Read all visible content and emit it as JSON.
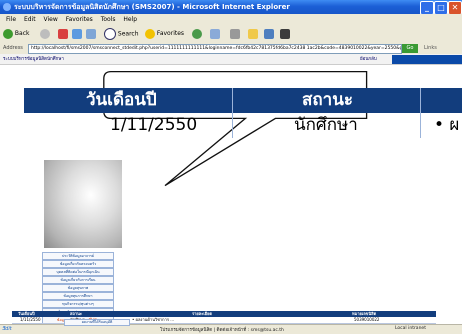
{
  "window": {
    "title": "ระบบบริหารจัดการข้อมูลนิสิตนักศึกษา (SMS2007) - Microsoft Internet Explorer",
    "minimize": "_",
    "maximize": "□",
    "close": "✕"
  },
  "menu": [
    "File",
    "Edit",
    "View",
    "Favorites",
    "Tools",
    "Help"
  ],
  "toolbar": {
    "back": "Back",
    "search": "Search",
    "favorites": "Favorites"
  },
  "address": {
    "label": "Address",
    "url": "http://localhost/fi/sms2007/smsconnect_stdedit.php?userid=1111111111111&loginname=fdc6fb42c781375fd6ba7c2438 1ac2b&code=4839010022&year=2550&groupid",
    "go": "Go",
    "links": "Links"
  },
  "page": {
    "header_title": "ระบบบริหารข้อมูลนิสิตนักศึกษา",
    "back_link": "ย้อนกลับ"
  },
  "sidebar": {
    "items": [
      "ประวัติข้อมูลอาจารย์",
      "ข้อมูลเกี่ยวกับครอบครัว",
      "บุคคลที่ติดต่อในกรณีฉุกเฉิน",
      "ข้อมูลเกี่ยวกับการเรียน",
      "ข้อมูลสุขภาพ",
      "ข้อมูลทุนการศึกษา",
      "ทุนกิจกรรม/ทุนต่างๆ",
      "ข้อมูลทักษะ/ความสามารถ",
      "ข้อมูลผลงาน/ผลงานที่ได้รับ"
    ],
    "active_index": 8
  },
  "small_table": {
    "headers": [
      "วันเดือนปี",
      "สถานะ",
      "รายละเอียด",
      "หมายเลขนิสิต"
    ],
    "row": [
      "1/11/2550",
      "นักศึกษา",
      "• ผลงานด้านวิชาการ ...",
      "5039010022"
    ],
    "footer_link": "ผลงานที่ได้รับอนุมัติ"
  },
  "zoom_table": {
    "headers": [
      "วันเดือนปี",
      "สถานะ"
    ],
    "row": [
      "1/11/2550",
      "นักศึกษา",
      "• ผ"
    ]
  },
  "status": {
    "left": "Ǝdit",
    "middle": "โปรแกรมจัดการข้อมูลนิสิต | ติดต่อเจ้าหน้าที่ : sms@tsu.ac.th",
    "right": "Local intranet"
  }
}
